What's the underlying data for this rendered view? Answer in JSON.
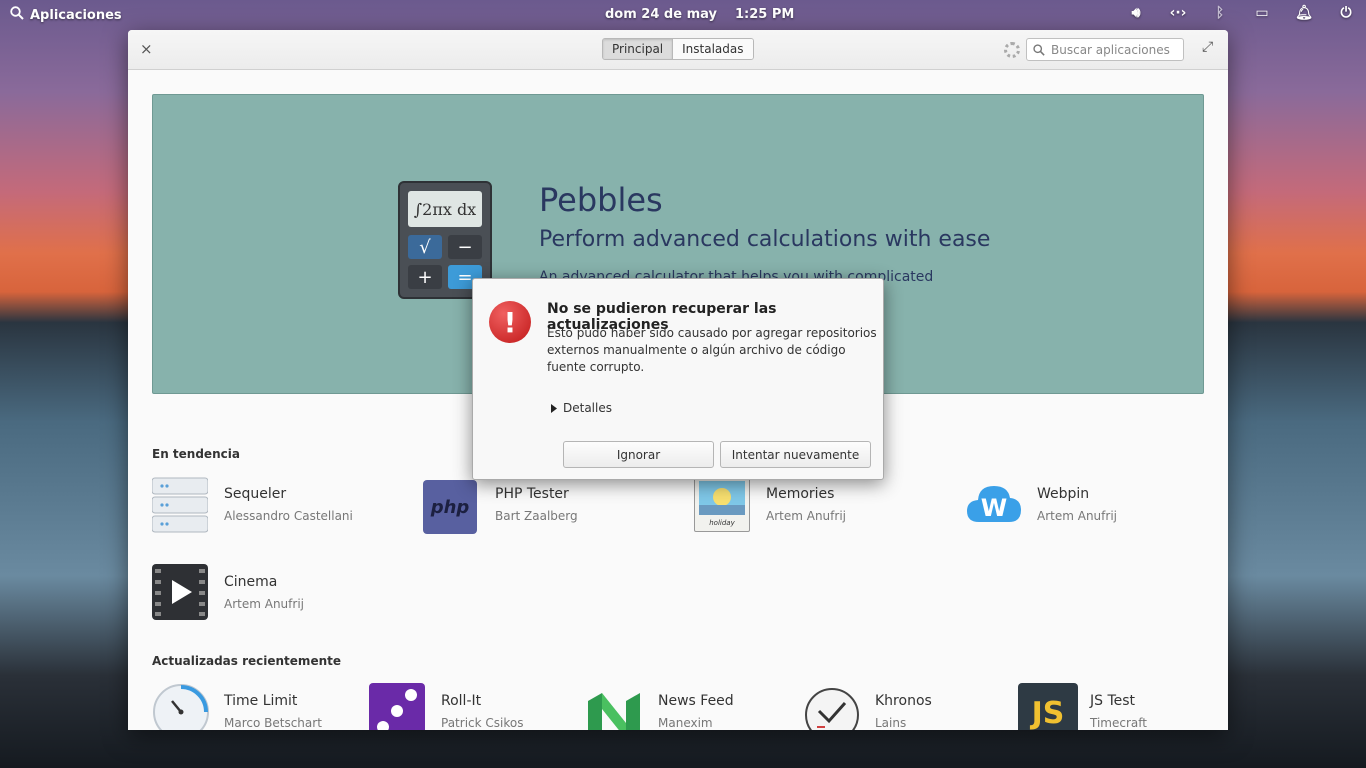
{
  "panel": {
    "apps_label": "Aplicaciones",
    "date": "dom 24 de may",
    "time": "1:25 PM"
  },
  "window": {
    "close": "×",
    "maximize": "⤢",
    "modes": [
      "Principal",
      "Instaladas"
    ],
    "search_placeholder": "Buscar aplicaciones"
  },
  "banner": {
    "title": "Pebbles",
    "subtitle": "Perform advanced calculations with ease",
    "description": "An advanced calculator that helps you with complicated",
    "calc_screen": "∫2πx dx",
    "calc_keys": [
      "√",
      "−",
      "+",
      "="
    ]
  },
  "sections": {
    "trending": "En tendencia",
    "recent": "Actualizadas recientemente"
  },
  "trending_apps": [
    {
      "name": "Sequeler",
      "author": "Alessandro Castellani"
    },
    {
      "name": "PHP Tester",
      "author": "Bart Zaalberg"
    },
    {
      "name": "Memories",
      "author": "Artem Anufrij"
    },
    {
      "name": "Webpin",
      "author": "Artem Anufrij"
    },
    {
      "name": "Cinema",
      "author": "Artem Anufrij"
    }
  ],
  "recent_apps": [
    {
      "name": "Time Limit",
      "author": "Marco Betschart"
    },
    {
      "name": "Roll-It",
      "author": "Patrick Csikos"
    },
    {
      "name": "News Feed",
      "author": "Manexim"
    },
    {
      "name": "Khronos",
      "author": "Lains"
    },
    {
      "name": "JS Test",
      "author": "Timecraft"
    }
  ],
  "icon_text": {
    "php": "php",
    "memories": "holiday",
    "webpin": "W",
    "js": "JS"
  },
  "dialog": {
    "title": "No se pudieron recuperar las actualizaciones",
    "message": "Esto pudo haber sido causado por agregar repositorios externos manualmente o algún archivo de código fuente corrupto.",
    "details_label": "Detalles",
    "ignore_button": "Ignorar",
    "retry_button": "Intentar nuevamente"
  },
  "colors": {
    "banner_bg": "#87b2ac",
    "banner_text": "#2a3860",
    "error": "#c01818"
  }
}
